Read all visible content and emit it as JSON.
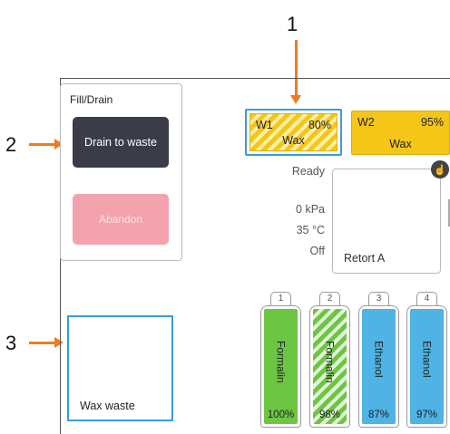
{
  "callouts": {
    "one": "1",
    "two": "2",
    "three": "3"
  },
  "fill_drain": {
    "title": "Fill/Drain",
    "drain_button": "Drain to waste",
    "abandon_button": "Abandon"
  },
  "wax_waste": {
    "label": "Wax waste"
  },
  "wax_baths": [
    {
      "id": "W1",
      "percent": "80%",
      "name": "Wax",
      "color": "#f5c518",
      "selected": true
    },
    {
      "id": "W2",
      "percent": "95%",
      "name": "Wax",
      "color": "#f5c518",
      "selected": false
    }
  ],
  "retort_status": {
    "state": "Ready",
    "pressure": "0 kPa",
    "temperature": "35 °C",
    "stirrer": "Off",
    "name": "Retort A"
  },
  "bottles": [
    {
      "number": "1",
      "reagent": "Formalin",
      "percent": "100%",
      "fill": 1.0,
      "color": "#6cc644",
      "pattern": "solid"
    },
    {
      "number": "2",
      "reagent": "Formalin",
      "percent": "98%",
      "fill": 1.0,
      "color": "#6cc644",
      "pattern": "striped"
    },
    {
      "number": "3",
      "reagent": "Ethanol",
      "percent": "87%",
      "fill": 1.0,
      "color": "#4fb3e6",
      "pattern": "solid"
    },
    {
      "number": "4",
      "reagent": "Ethanol",
      "percent": "97%",
      "fill": 1.0,
      "color": "#4fb3e6",
      "pattern": "solid"
    }
  ],
  "icons": {
    "manual_operation": "hand-pointer-icon"
  },
  "accent_colors": {
    "callout_arrow": "#f07a20",
    "selection_border": "#3a9be0",
    "drain_button": "#3a3d48",
    "abandon_button": "#f2a3ae"
  }
}
